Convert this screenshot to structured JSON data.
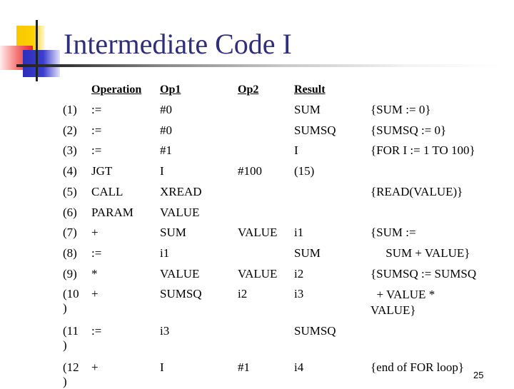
{
  "slide": {
    "title": "Intermediate Code I",
    "page_number": "25"
  },
  "table": {
    "headers": {
      "operation": "Operation",
      "op1": "Op1",
      "op2": "Op2",
      "result": "Result"
    },
    "rows": [
      {
        "num": "(1)",
        "op": ":=",
        "op1": "#0",
        "op2": "",
        "result": "SUM",
        "comment": "{SUM := 0}"
      },
      {
        "num": "(2)",
        "op": ":=",
        "op1": "#0",
        "op2": "",
        "result": "SUMSQ",
        "comment": "{SUMSQ := 0}"
      },
      {
        "num": "(3)",
        "op": ":=",
        "op1": "#1",
        "op2": "",
        "result": "I",
        "comment": "{FOR I := 1 TO 100}"
      },
      {
        "num": "(4)",
        "op": "JGT",
        "op1": "I",
        "op2": "#100",
        "result": "(15)",
        "comment": ""
      },
      {
        "num": "(5)",
        "op": "CALL",
        "op1": "XREAD",
        "op2": "",
        "result": "",
        "comment": "{READ(VALUE)}"
      },
      {
        "num": "(6)",
        "op": "PARAM",
        "op1": "VALUE",
        "op2": "",
        "result": "",
        "comment": ""
      },
      {
        "num": "(7)",
        "op": "+",
        "op1": "SUM",
        "op2": "VALUE",
        "result": "i1",
        "comment": "{SUM :="
      },
      {
        "num": "(8)",
        "op": ":=",
        "op1": "i1",
        "op2": "",
        "result": "SUM",
        "comment": "     SUM + VALUE}"
      },
      {
        "num": "(9)",
        "op": "*",
        "op1": "VALUE",
        "op2": "VALUE",
        "result": "i2",
        "comment": "{SUMSQ := SUMSQ"
      },
      {
        "num": "(10\n)",
        "op": "+",
        "op1": "SUMSQ",
        "op2": "i2",
        "result": "i3",
        "comment": "  + VALUE *\nVALUE}"
      },
      {
        "num": "(11\n)",
        "op": ":=",
        "op1": "i3",
        "op2": "",
        "result": "SUMSQ",
        "comment": ""
      },
      {
        "num": "(12\n)",
        "op": "+",
        "op1": "I",
        "op2": "#1",
        "result": "i4",
        "comment": "{end of FOR loop}"
      }
    ]
  }
}
